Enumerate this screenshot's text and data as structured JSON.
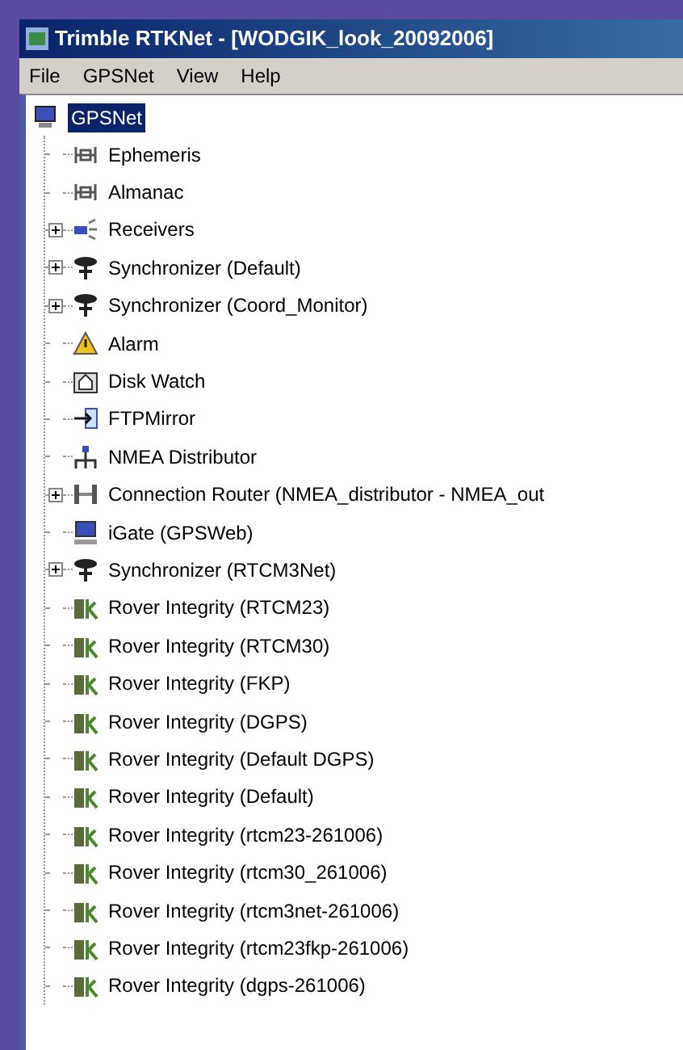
{
  "window": {
    "title": "Trimble RTKNet - [WODGIK_look_20092006]"
  },
  "menu": [
    "File",
    "GPSNet",
    "View",
    "Help"
  ],
  "tree": {
    "label": "GPSNet",
    "kind": "network",
    "selected": true,
    "children": [
      {
        "label": "Ephemeris",
        "kind": "satellite"
      },
      {
        "label": "Almanac",
        "kind": "satellite"
      },
      {
        "label": "Receivers",
        "kind": "receivers",
        "expanded": false
      },
      {
        "label": "Synchronizer (Default)",
        "kind": "synchronizer",
        "expanded": false
      },
      {
        "label": "Synchronizer (Coord_Monitor)",
        "kind": "synchronizer",
        "expanded": false
      },
      {
        "label": "Alarm",
        "kind": "alarm"
      },
      {
        "label": "Disk Watch",
        "kind": "disk"
      },
      {
        "label": "FTPMirror",
        "kind": "ftp"
      },
      {
        "label": "NMEA Distributor",
        "kind": "nmea"
      },
      {
        "label": "Connection Router (NMEA_distributor - NMEA_out",
        "kind": "router",
        "expanded": false
      },
      {
        "label": "iGate (GPSWeb)",
        "kind": "igate"
      },
      {
        "label": "Synchronizer (RTCM3Net)",
        "kind": "synchronizer",
        "expanded": false
      },
      {
        "label": "Rover Integrity (RTCM23)",
        "kind": "rover"
      },
      {
        "label": "Rover Integrity (RTCM30)",
        "kind": "rover"
      },
      {
        "label": "Rover Integrity (FKP)",
        "kind": "rover"
      },
      {
        "label": "Rover Integrity (DGPS)",
        "kind": "rover"
      },
      {
        "label": "Rover Integrity (Default DGPS)",
        "kind": "rover"
      },
      {
        "label": "Rover Integrity (Default)",
        "kind": "rover"
      },
      {
        "label": "Rover Integrity (rtcm23-261006)",
        "kind": "rover"
      },
      {
        "label": "Rover Integrity (rtcm30_261006)",
        "kind": "rover"
      },
      {
        "label": "Rover Integrity (rtcm3net-261006)",
        "kind": "rover"
      },
      {
        "label": "Rover Integrity (rtcm23fkp-261006)",
        "kind": "rover"
      },
      {
        "label": "Rover Integrity (dgps-261006)",
        "kind": "rover"
      }
    ]
  }
}
